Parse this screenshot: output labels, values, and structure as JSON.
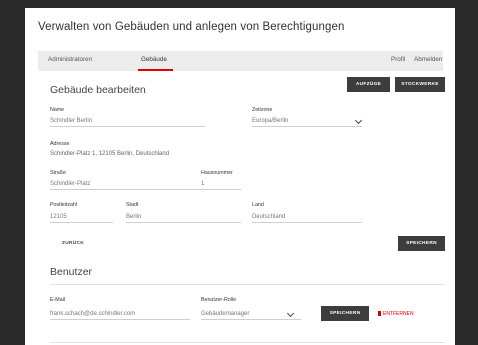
{
  "page": {
    "title": "Verwalten von Gebäuden und anlegen von Berechtigungen"
  },
  "nav": {
    "tabs": [
      {
        "label": "Administratoren"
      },
      {
        "label": "Gebäude"
      }
    ],
    "profile": "Profil",
    "logout": "Abmelden"
  },
  "building": {
    "title": "Gebäude bearbeiten",
    "elevators_button": "AUFZÜGE",
    "floors_button": "STOCKWERKE",
    "name": {
      "label": "Name",
      "value": "Schindler Berlin"
    },
    "timezone": {
      "label": "Zeitzone",
      "value": "Europa/Berlin"
    },
    "address": {
      "label": "Adresse",
      "value": "Schindler-Platz 1, 12105 Berlin, Deutschland"
    },
    "street": {
      "label": "Straße",
      "value": "Schindler-Platz"
    },
    "house_number": {
      "label": "Hausnummer",
      "value": "1"
    },
    "postal_code": {
      "label": "Postleitzahl",
      "value": "12105"
    },
    "city": {
      "label": "Stadt",
      "value": "Berlin"
    },
    "country": {
      "label": "Land",
      "value": "Deutschland"
    },
    "back": "ZURÜCK",
    "save": "SPEICHERN"
  },
  "users": {
    "title": "Benutzer",
    "email": {
      "label": "E-Mail",
      "value": "frank.schach@de.schindler.com"
    },
    "role": {
      "label": "Benutzer-Rolle",
      "value": "Gebäudemanager"
    },
    "save": "SPEICHERN",
    "remove": "ENTFERNEN"
  }
}
